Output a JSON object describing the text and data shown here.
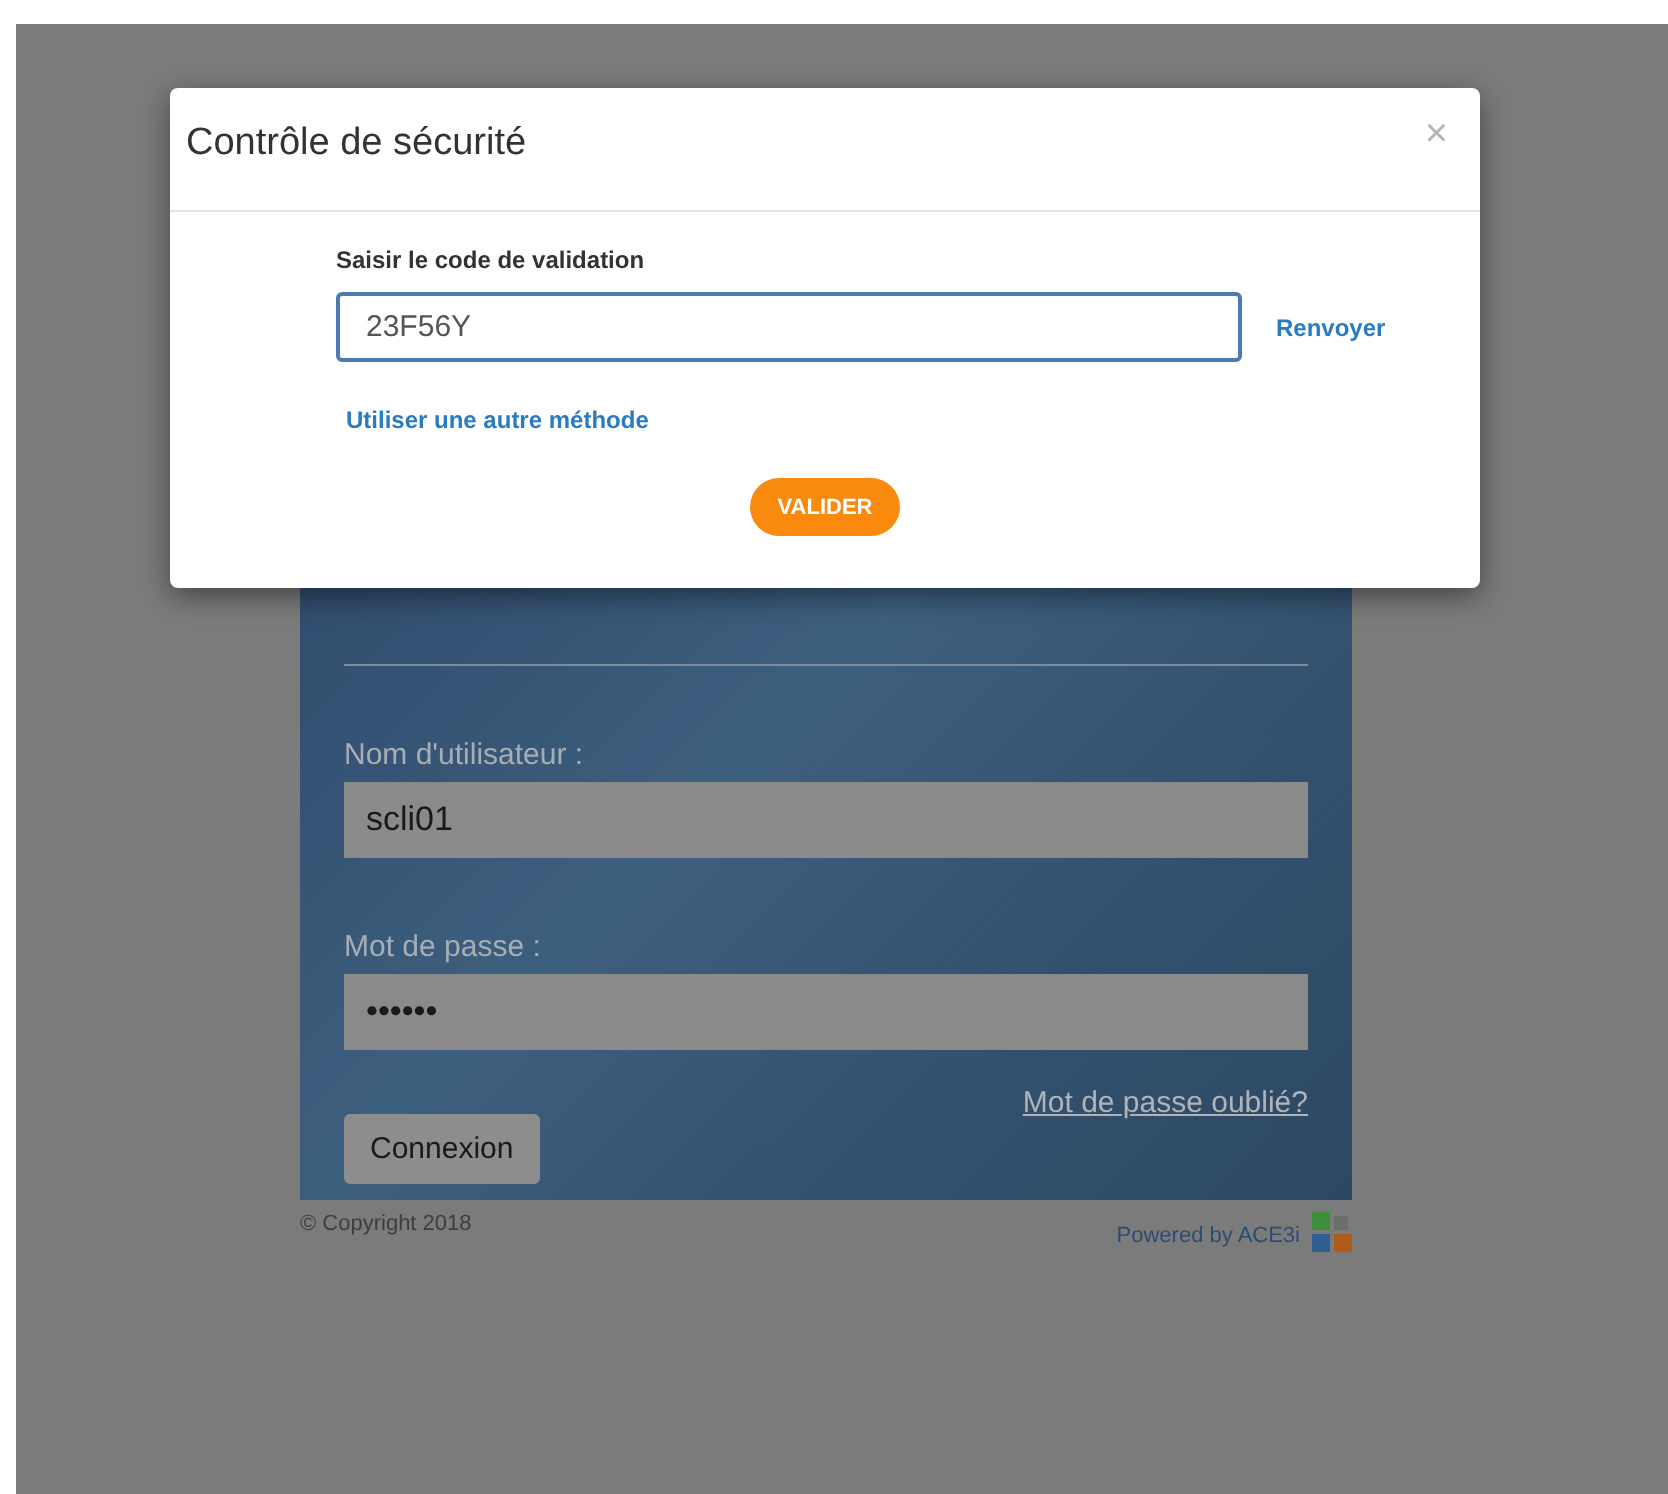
{
  "login": {
    "fields": [
      {
        "label": "Nom d'utilisateur :",
        "value": "scli01"
      },
      {
        "label": "Mot de passe :",
        "value": "••••••"
      }
    ],
    "forgot_link": "Mot de passe oublié?",
    "submit": "Connexion"
  },
  "footer": {
    "copyright": "© Copyright 2018",
    "powered_by": "Powered by ACE3i"
  },
  "dialog": {
    "title": "Contrôle de sécurité",
    "close": "×",
    "code_label": "Saisir le code de validation",
    "code_value": "23F56Y",
    "code_focused": true,
    "resend_link": "Renvoyer",
    "other_method_link": "Utiliser une autre méthode",
    "submit": "VALIDER"
  }
}
